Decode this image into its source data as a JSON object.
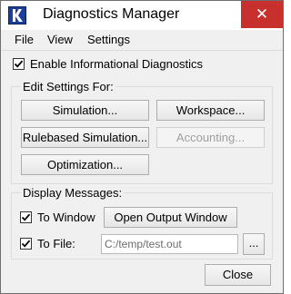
{
  "window": {
    "title": "Diagnostics Manager",
    "close_glyph": "✕",
    "app_icon": "riverware-logo-icon"
  },
  "menu": [
    {
      "label": "File"
    },
    {
      "label": "View"
    },
    {
      "label": "Settings"
    }
  ],
  "informational": {
    "label": "Enable Informational Diagnostics",
    "checked": true
  },
  "edit_settings": {
    "title": "Edit Settings For:",
    "simulation": "Simulation...",
    "workspace": "Workspace...",
    "rulebased": "Rulebased Simulation...",
    "accounting": "Accounting...",
    "optimization": "Optimization..."
  },
  "display": {
    "title": "Display Messages:",
    "to_window_label": "To Window",
    "to_window_checked": true,
    "open_output": "Open Output Window",
    "to_file_label": "To File:",
    "to_file_checked": true,
    "file_path": "C:/temp/test.out",
    "browse": "..."
  },
  "footer": {
    "close": "Close"
  }
}
